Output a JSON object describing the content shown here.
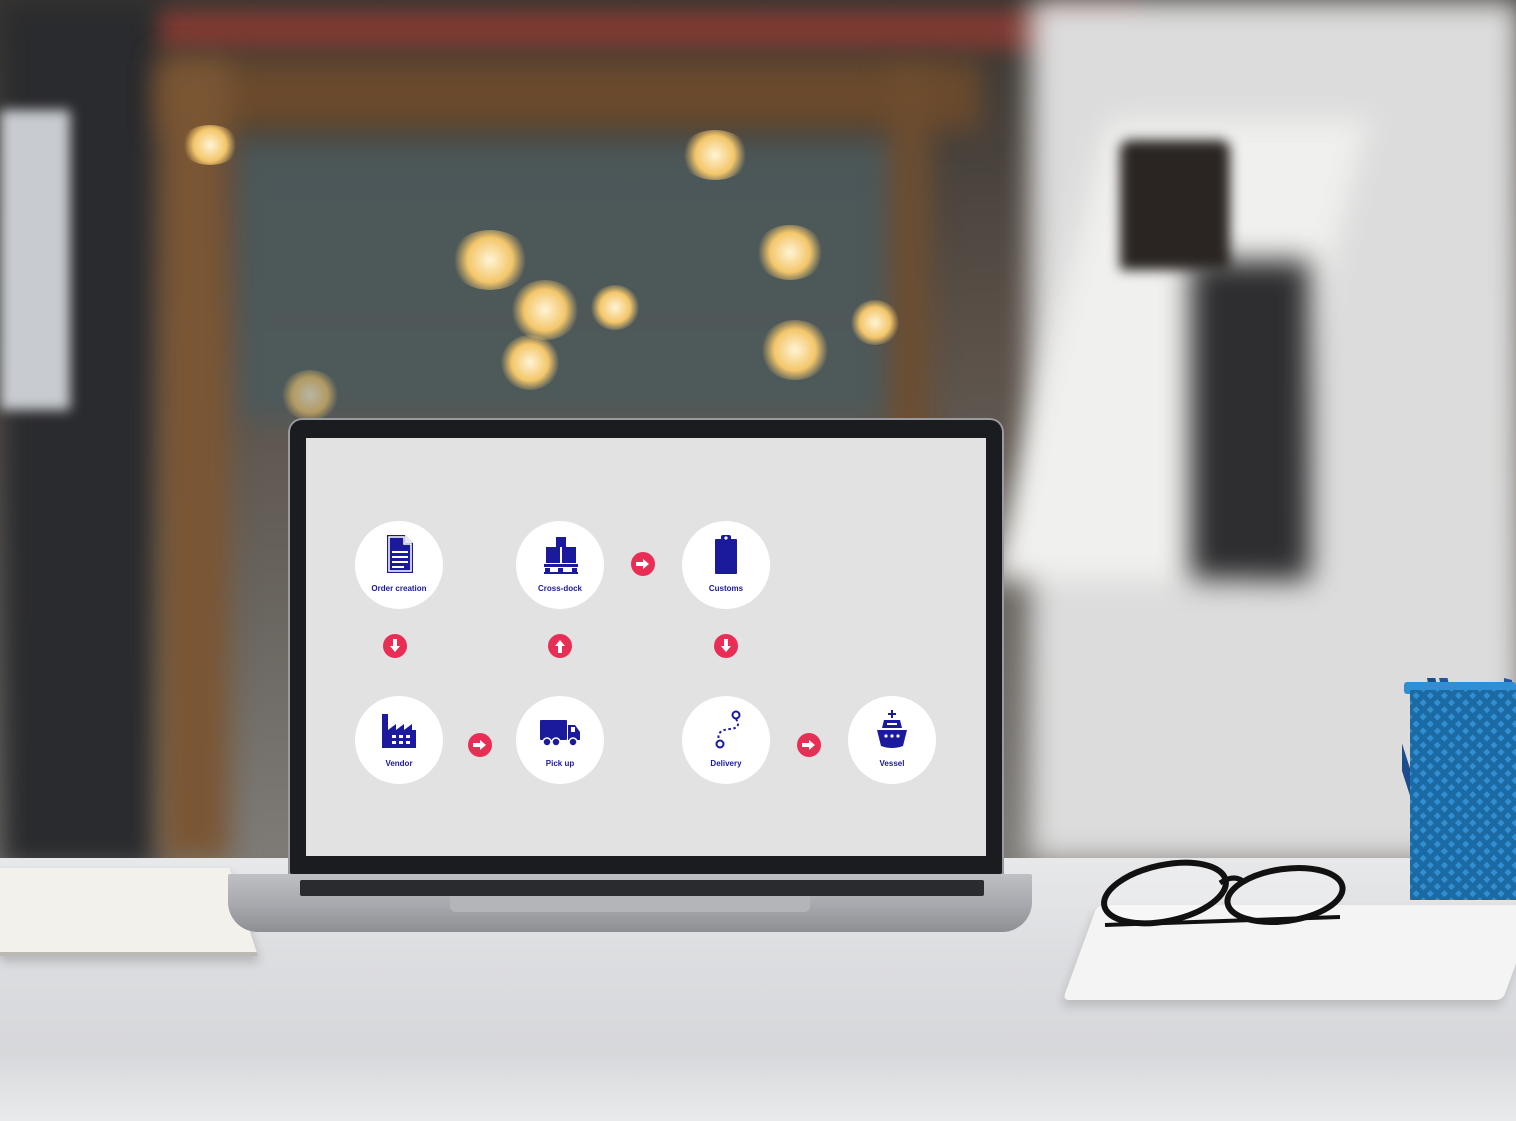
{
  "diagram": {
    "icon_color": "#1b1a9c",
    "connector_color": "#e92e56",
    "screen_color": "#e2e2e2",
    "nodes": {
      "order_creation": {
        "label": "Order creation",
        "icon": "document-icon"
      },
      "cross_dock": {
        "label": "Cross-dock",
        "icon": "pallet-boxes-icon"
      },
      "customs": {
        "label": "Customs",
        "icon": "clipboard-icon"
      },
      "vendor": {
        "label": "Vendor",
        "icon": "factory-icon"
      },
      "pick_up": {
        "label": "Pick up",
        "icon": "truck-icon"
      },
      "delivery": {
        "label": "Delivery",
        "icon": "route-icon"
      },
      "vessel": {
        "label": "Vessel",
        "icon": "ship-icon"
      }
    },
    "connectors": [
      {
        "from": "Order creation",
        "to": "Vendor",
        "direction": "down"
      },
      {
        "from": "Vendor",
        "to": "Pick up",
        "direction": "right"
      },
      {
        "from": "Pick up",
        "to": "Cross-dock",
        "direction": "up"
      },
      {
        "from": "Cross-dock",
        "to": "Customs",
        "direction": "right"
      },
      {
        "from": "Customs",
        "to": "Delivery",
        "direction": "down"
      },
      {
        "from": "Delivery",
        "to": "Vessel",
        "direction": "right"
      }
    ]
  }
}
